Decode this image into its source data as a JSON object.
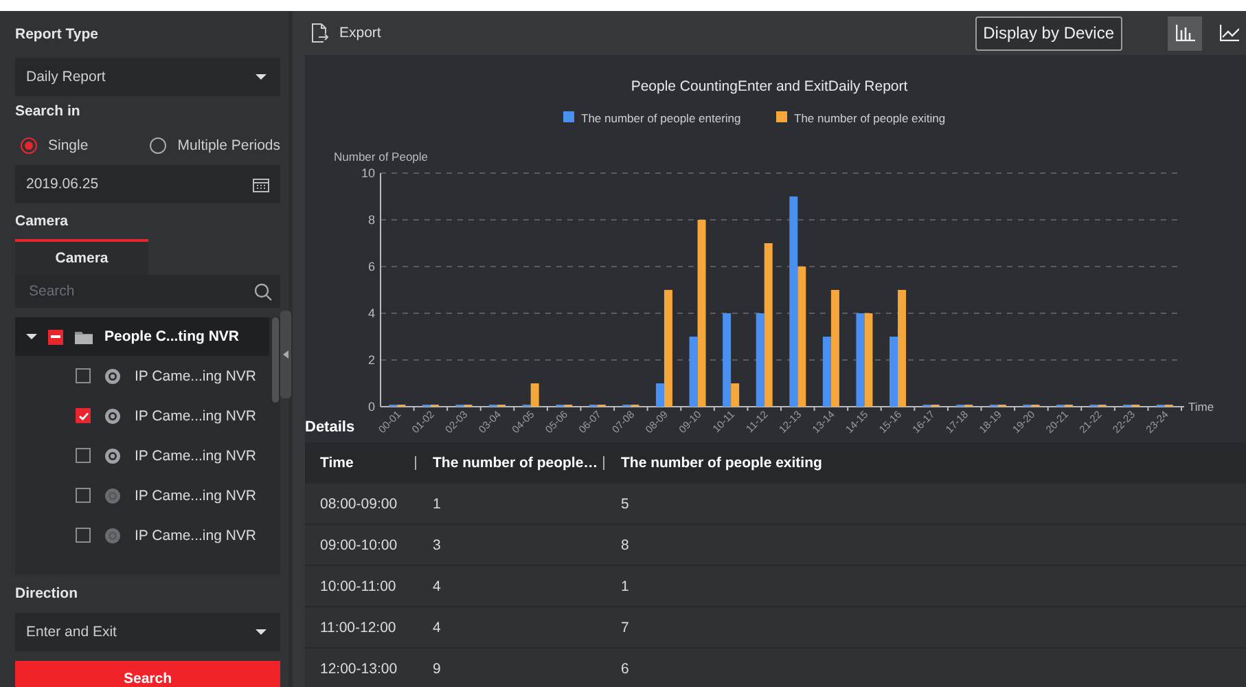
{
  "sidebar": {
    "report_type": {
      "label": "Report Type",
      "value": "Daily Report"
    },
    "search_in": {
      "label": "Search in",
      "options": [
        {
          "label": "Single",
          "selected": true
        },
        {
          "label": "Multiple Periods",
          "selected": false
        }
      ],
      "date": "2019.06.25"
    },
    "camera": {
      "label": "Camera",
      "tabs": [
        {
          "label": "Camera",
          "selected": true
        }
      ],
      "search_placeholder": "Search",
      "tree": [
        {
          "label": "People C...ting NVR",
          "expanded": true,
          "checked": false,
          "indeterminate": true,
          "selected": true,
          "children": [
            {
              "label": "IP Came...ing NVR",
              "checked": false,
              "online": true,
              "selected": false
            },
            {
              "label": "IP Came...ing NVR",
              "checked": true,
              "online": true,
              "selected": false
            },
            {
              "label": "IP Came...ing NVR",
              "checked": false,
              "online": true,
              "selected": false
            },
            {
              "label": "IP Came...ing NVR",
              "checked": false,
              "online": false,
              "selected": false
            },
            {
              "label": "IP Came...ing NVR",
              "checked": false,
              "online": false,
              "selected": false
            }
          ]
        }
      ]
    },
    "direction": {
      "label": "Direction",
      "value": "Enter and Exit"
    },
    "search_button": "Search"
  },
  "toolbar": {
    "export": "Export",
    "display_button": "Display by Device",
    "views": [
      {
        "kind": "bar",
        "selected": true
      },
      {
        "kind": "line",
        "selected": false
      }
    ]
  },
  "chart": {
    "chart_data": {
      "type": "bar",
      "title": "People CountingEnter and ExitDaily Report",
      "ylabel": "Number of People",
      "xlabel": "Time",
      "categories": [
        "00-01",
        "01-02",
        "02-03",
        "03-04",
        "04-05",
        "05-06",
        "06-07",
        "07-08",
        "08-09",
        "09-10",
        "10-11",
        "11-12",
        "12-13",
        "13-14",
        "14-15",
        "15-16",
        "16-17",
        "17-18",
        "18-19",
        "19-20",
        "20-21",
        "21-22",
        "22-23",
        "23-24"
      ],
      "series": [
        {
          "name": "The number of people entering",
          "color": "#4a90f0",
          "values": [
            0,
            0,
            0,
            0,
            0,
            0,
            0,
            0,
            1,
            3,
            4,
            4,
            9,
            3,
            4,
            3,
            0,
            0,
            0,
            0,
            0,
            0,
            0,
            0
          ]
        },
        {
          "name": "The number of people exiting",
          "color": "#f5a73c",
          "values": [
            0,
            0,
            0,
            0,
            1,
            0,
            0,
            0,
            5,
            8,
            1,
            7,
            6,
            5,
            4,
            5,
            0,
            0,
            0,
            0,
            0,
            0,
            0,
            0
          ]
        }
      ],
      "ylim": [
        0,
        10
      ],
      "yticks": [
        0,
        2,
        4,
        6,
        8,
        10
      ],
      "grid": true,
      "legend": true
    }
  },
  "details": {
    "label": "Details",
    "columns": [
      "Time",
      "The number of people…",
      "The number of people exiting"
    ],
    "rows": [
      [
        "08:00-09:00",
        "1",
        "5"
      ],
      [
        "09:00-10:00",
        "3",
        "8"
      ],
      [
        "10:00-11:00",
        "4",
        "1"
      ],
      [
        "11:00-12:00",
        "4",
        "7"
      ],
      [
        "12:00-13:00",
        "9",
        "6"
      ]
    ]
  }
}
